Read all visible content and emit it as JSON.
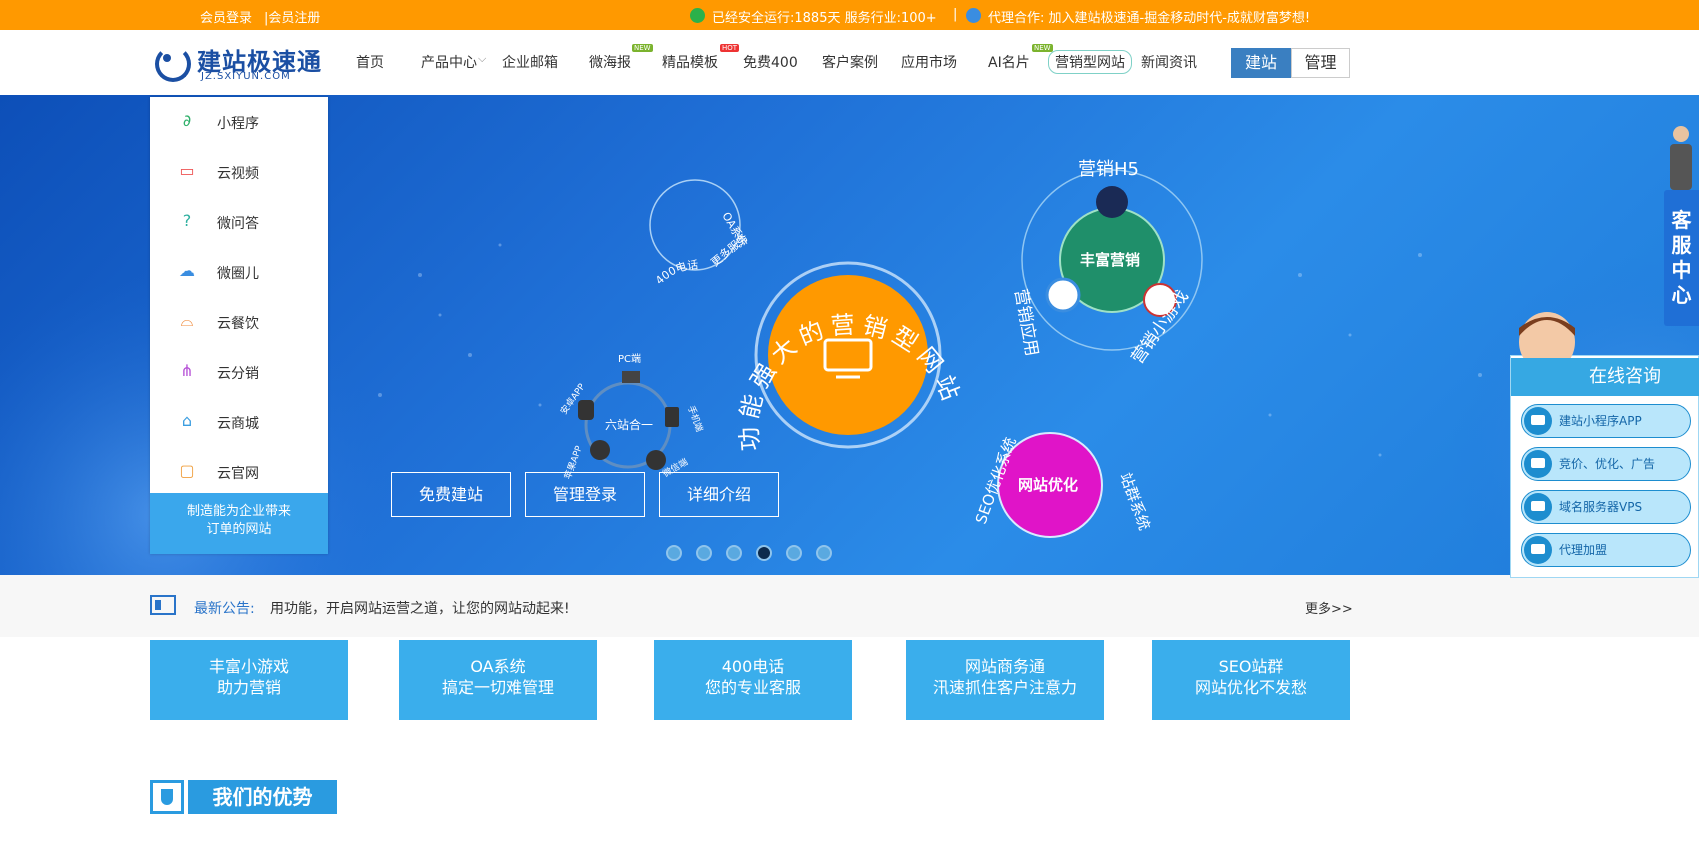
{
  "topbar": {
    "login": "会员登录",
    "register": "|会员注册",
    "uptime": "已经安全运行:1885天 服务行业:100+",
    "sep": "|",
    "agent": "代理合作:  加入建站极速通-掘金移动时代-成就财富梦想!"
  },
  "logo": {
    "name": "建站极速通",
    "domain": "JZ.SXIYUN.COM"
  },
  "nav": {
    "home": "首页",
    "products": "产品中心",
    "email": "企业邮箱",
    "weihaibao": "微海报",
    "templates": "精品模板",
    "free400": "免费400",
    "cases": "客户案例",
    "market": "应用市场",
    "ai": "AI名片",
    "marketing_site": "营销型网站",
    "news": "新闻资讯",
    "badge_new": "NEW",
    "badge_hot": "HOT",
    "btn_build": "建站",
    "btn_manage": "管理"
  },
  "side_menu": {
    "items": [
      {
        "label": "小程序",
        "icon": "mini-program-icon",
        "glyph": "∂",
        "color": "#2fb06a"
      },
      {
        "label": "云视频",
        "icon": "video-camera-icon",
        "glyph": "▭",
        "color": "#e55"
      },
      {
        "label": "微问答",
        "icon": "question-bubble-icon",
        "glyph": "?",
        "color": "#2fb0a0"
      },
      {
        "label": "微圈儿",
        "icon": "chat-bubbles-icon",
        "glyph": "☁",
        "color": "#3a8de0"
      },
      {
        "label": "云餐饮",
        "icon": "food-cover-icon",
        "glyph": "⌓",
        "color": "#f08a3a"
      },
      {
        "label": "云分销",
        "icon": "network-nodes-icon",
        "glyph": "⋔",
        "color": "#b54fd6"
      },
      {
        "label": "云商城",
        "icon": "store-icon",
        "glyph": "⌂",
        "color": "#3a9de0"
      },
      {
        "label": "云官网",
        "icon": "monitor-icon",
        "glyph": "▢",
        "color": "#f0a040"
      }
    ],
    "footer": "制造能为企业带来\n订单的网站"
  },
  "banner": {
    "arc_title": "功能强大的营销型网站",
    "hub_a_items": [
      "400电话",
      "OA系统",
      "更多服务"
    ],
    "six_in_one": "六站合一",
    "six_labels": [
      "PC端",
      "手机端",
      "微信端",
      "苹果APP",
      "安卓APP"
    ],
    "h5": "营销H5",
    "rich_marketing": "丰富营销",
    "marketing_app": "营销应用",
    "marketing_game": "营销小游戏",
    "seo": "SEO优化系统",
    "site_opt": "网站优化",
    "site_group": "站群系统",
    "buttons": [
      "免费建站",
      "管理登录",
      "详细介绍"
    ],
    "slides": 6,
    "active_slide": 4
  },
  "notice": {
    "title": "最新公告:",
    "text": "用功能，开启网站运营之道，让您的网站动起来!",
    "more": "更多>>"
  },
  "cards": [
    [
      "丰富小游戏",
      "助力营销"
    ],
    [
      "OA系统",
      "搞定一切难管理"
    ],
    [
      "400电话",
      "您的专业客服"
    ],
    [
      "网站商务通",
      "汛速抓住客户注意力"
    ],
    [
      "SEO站群",
      "网站优化不发愁"
    ]
  ],
  "advantages": {
    "title": "我们的优势"
  },
  "service": {
    "kefu": "客服中心",
    "online_title": "在线咨询",
    "items": [
      "建站小程序APP",
      "竞价、优化、广告",
      "域名服务器VPS",
      "代理加盟"
    ]
  },
  "colors": {
    "topbar": "#ff9900",
    "accent": "#3aaeec",
    "brand": "#1b4fa3",
    "orange_hub": "#ff9900",
    "green_hub": "#1f8f6a",
    "magenta_hub": "#e014c8"
  }
}
